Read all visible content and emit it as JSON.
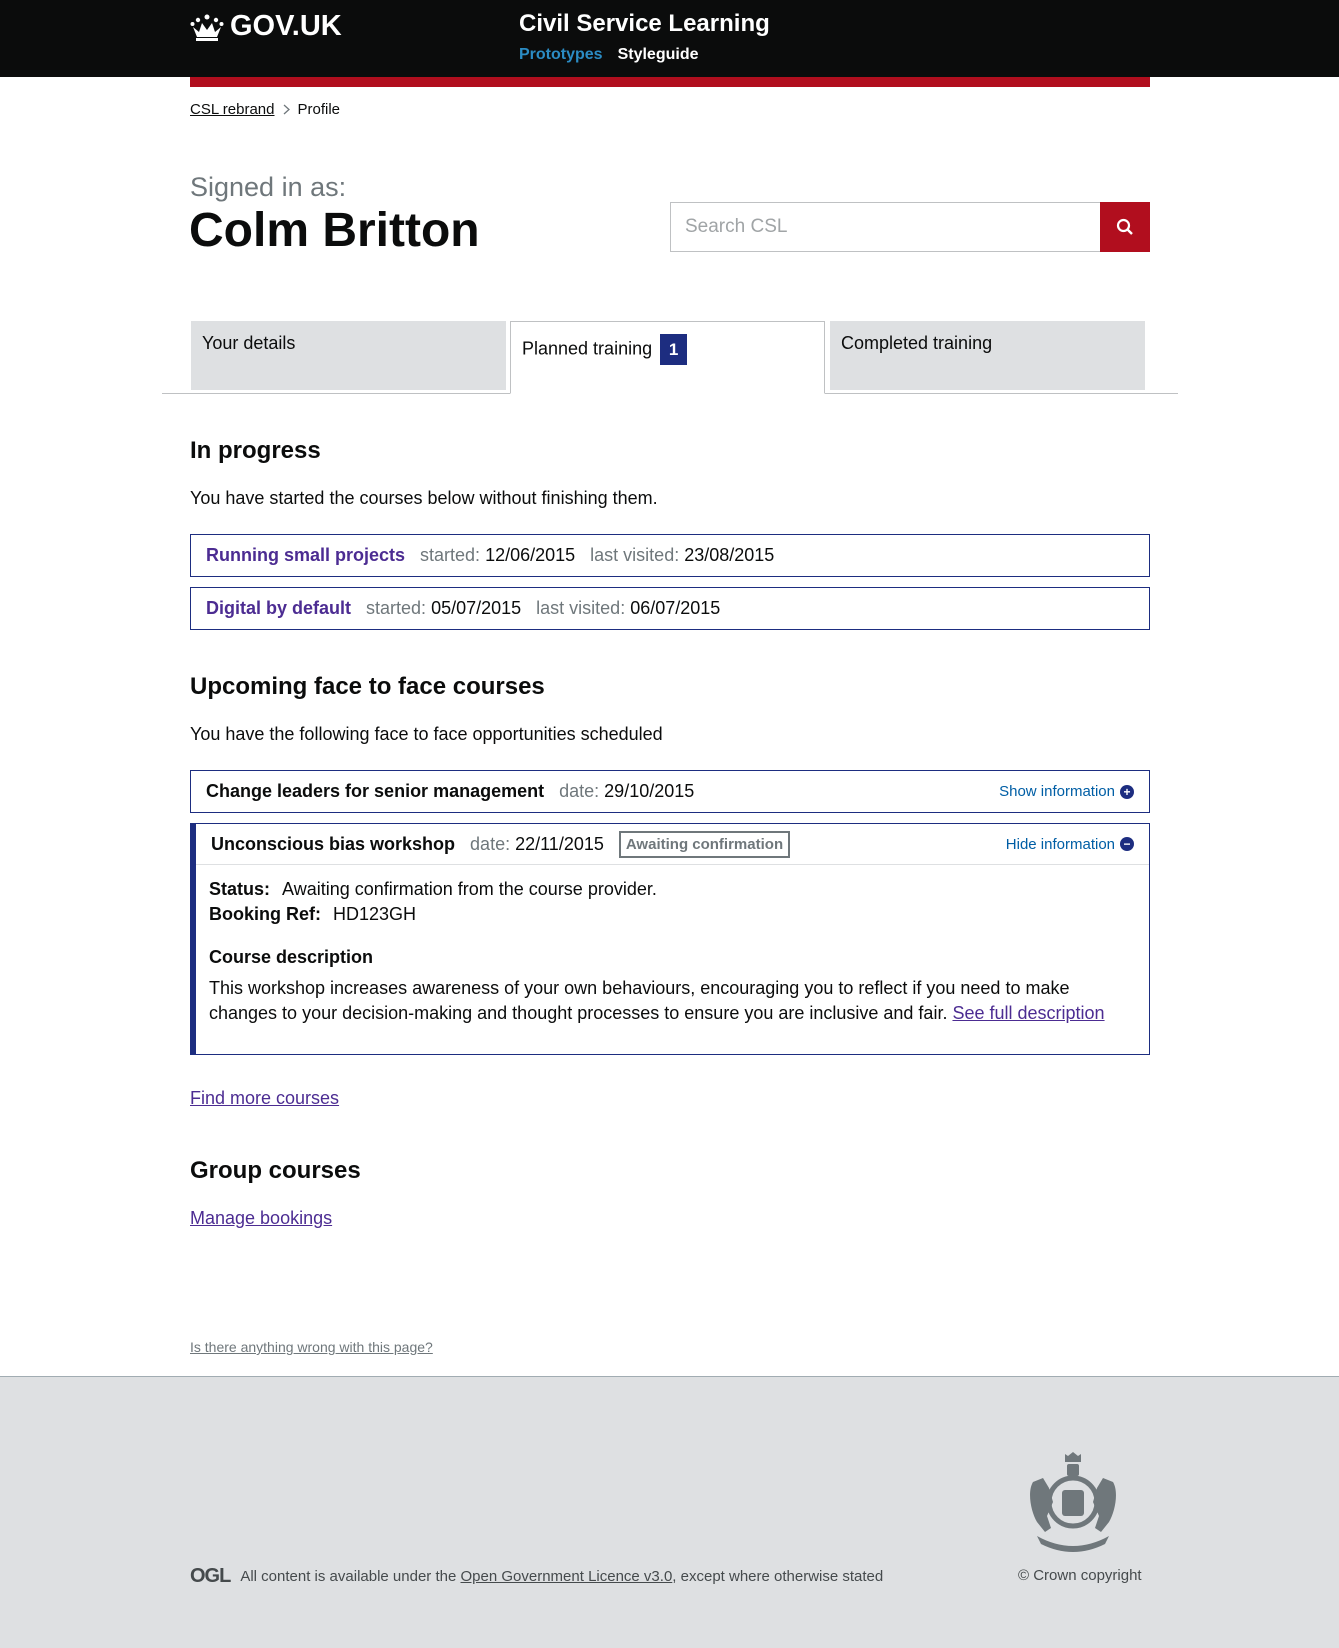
{
  "header": {
    "logo_text": "GOV.UK",
    "service_name": "Civil Service Learning",
    "nav": [
      "Prototypes",
      "Styleguide"
    ]
  },
  "breadcrumb": {
    "items": [
      "CSL rebrand",
      "Profile"
    ]
  },
  "profile": {
    "signed_in_label": "Signed in as:",
    "user_name": "Colm Britton"
  },
  "search": {
    "placeholder": "Search CSL"
  },
  "tabs": [
    {
      "label": "Your details"
    },
    {
      "label": "Planned training",
      "badge": "1"
    },
    {
      "label": "Completed training"
    }
  ],
  "in_progress": {
    "heading": "In progress",
    "intro": "You have started the courses below without finishing them.",
    "courses": [
      {
        "title": "Running small projects",
        "started_label": "started:",
        "started": "12/06/2015",
        "visited_label": "last visited:",
        "visited": "23/08/2015"
      },
      {
        "title": "Digital by default",
        "started_label": "started:",
        "started": "05/07/2015",
        "visited_label": "last visited:",
        "visited": "06/07/2015"
      }
    ]
  },
  "upcoming": {
    "heading": "Upcoming face to face courses",
    "intro": "You have the following face to face opportunities scheduled",
    "courses": [
      {
        "title": "Change leaders for senior management",
        "date_label": "date:",
        "date": "29/10/2015",
        "toggle": "Show information"
      },
      {
        "title": "Unconscious bias workshop",
        "date_label": "date:",
        "date": "22/11/2015",
        "badge": "Awaiting confirmation",
        "toggle": "Hide information",
        "status_label": "Status:",
        "status": "Awaiting confirmation from the course provider.",
        "ref_label": "Booking Ref:",
        "ref": "HD123GH",
        "description_title": "Course description",
        "description": "This workshop increases awareness of your own behaviours, encouraging you to reflect if you need to make changes to your decision-making and thought processes to ensure you are inclusive and fair.",
        "description_link": "See full description"
      }
    ],
    "find_more": "Find more courses"
  },
  "group": {
    "heading": "Group courses",
    "link": "Manage bookings"
  },
  "report_link": "Is there anything wrong with this page?",
  "footer": {
    "ogl_logo": "OGL",
    "licence_prefix": "All content is available under the",
    "licence_link": "Open Government Licence v3.0",
    "licence_suffix": ", except where otherwise stated",
    "copyright": "© Crown copyright"
  }
}
